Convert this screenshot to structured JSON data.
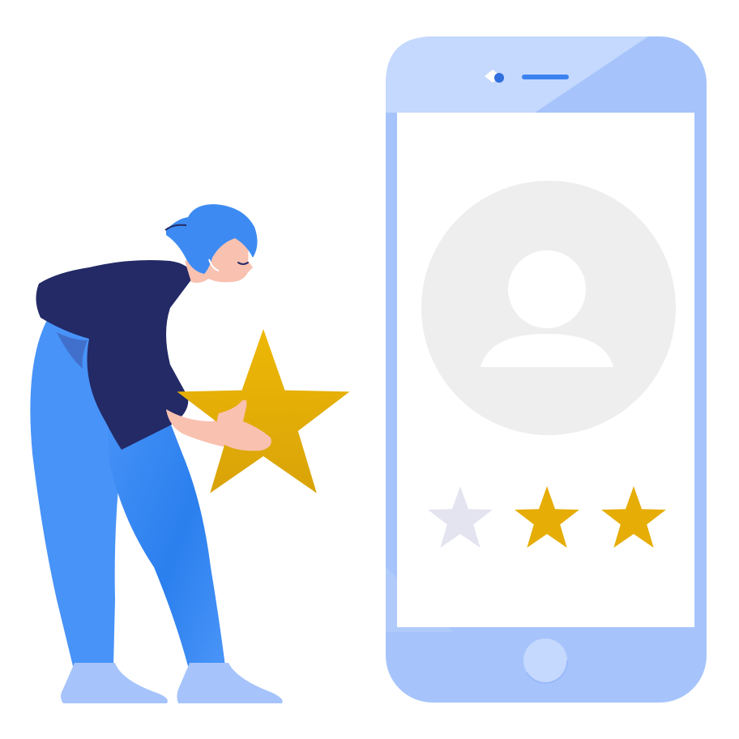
{
  "illustration": {
    "colors": {
      "background": "#ffffff",
      "phone_frame": "#a6c4fb",
      "phone_frame_light": "#c5d8fd",
      "phone_screen": "#ffffff",
      "avatar_circle": "#eeeeee",
      "star_gold": "#e6ad07",
      "star_empty": "#e3e4ef",
      "shirt": "#232a66",
      "pants": "#3e8ef7",
      "hair": "#3d8bf2",
      "skin": "#f9c1b0",
      "shoes": "#a6c4fb"
    },
    "rating": {
      "filled": 2,
      "max": 3
    },
    "icons": [
      "phone-icon",
      "user-avatar-icon",
      "star-icon",
      "home-button-icon",
      "person-figure"
    ]
  }
}
